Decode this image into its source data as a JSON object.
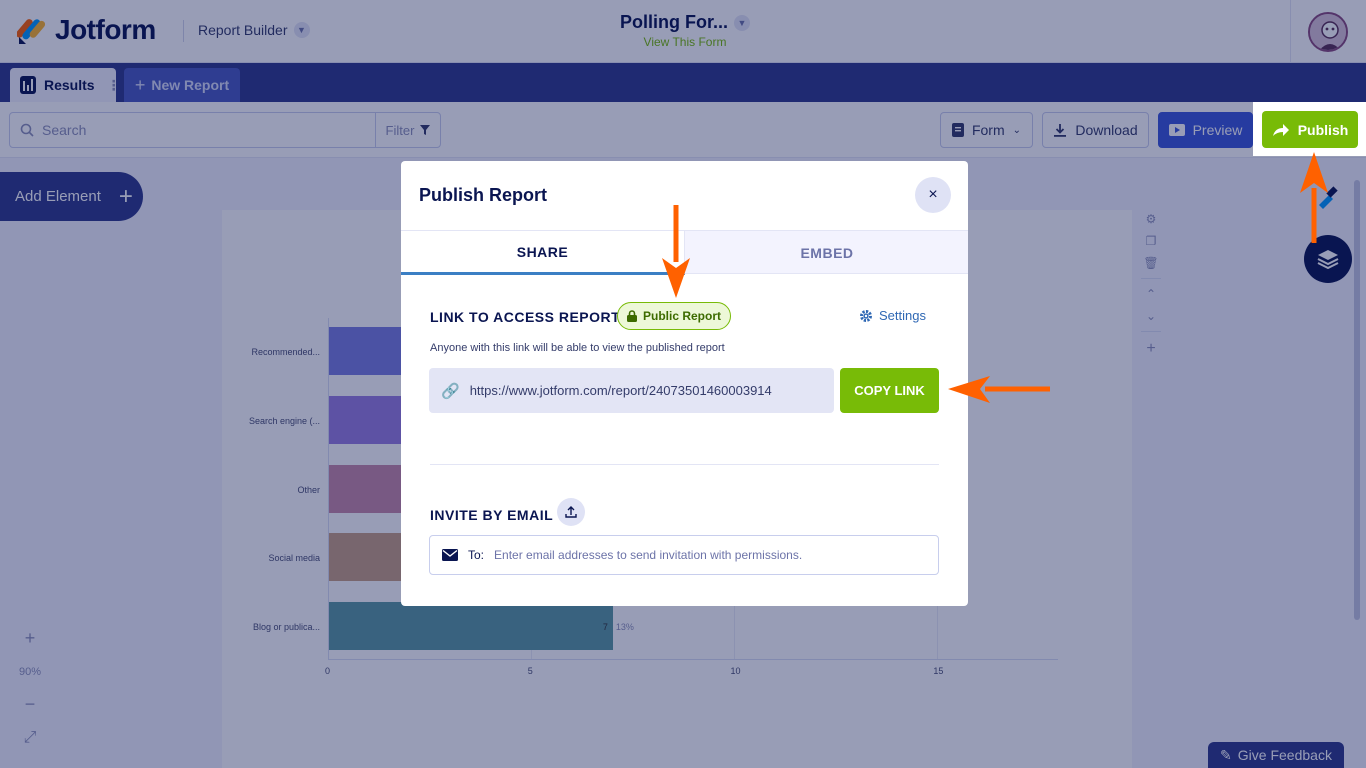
{
  "header": {
    "brand": "Jotform",
    "app_name": "Report Builder",
    "form_title": "Polling For...",
    "form_subtitle": "View This Form"
  },
  "tabs": {
    "results_label": "Results",
    "new_report_label": "New Report"
  },
  "toolbar": {
    "search_placeholder": "Search",
    "filter_label": "Filter",
    "form_label": "Form",
    "download_label": "Download",
    "preview_label": "Preview",
    "publish_label": "Publish"
  },
  "canvas": {
    "add_element_label": "Add Element",
    "zoom_level": "90%",
    "feedback_label": "Give Feedback"
  },
  "chart_data": {
    "type": "bar",
    "orientation": "horizontal",
    "categories": [
      "Recommended...",
      "Search engine (...",
      "Other",
      "Social media",
      "Blog or publica..."
    ],
    "values": [
      null,
      null,
      null,
      null,
      7
    ],
    "value_labels": [
      "",
      "",
      "",
      "",
      "7"
    ],
    "percent_labels": [
      "",
      "",
      "",
      "",
      "13%"
    ],
    "colors": [
      "#7b7fe0",
      "#9a7ee0",
      "#c98aa8",
      "#c9a084",
      "#5c9aa0"
    ],
    "xticks": [
      "0",
      "5",
      "10",
      "15"
    ],
    "xlim": [
      0,
      18
    ]
  },
  "modal": {
    "title": "Publish Report",
    "close_symbol": "×",
    "tab_share": "SHARE",
    "tab_embed": "EMBED",
    "link_section_title": "LINK TO ACCESS REPORT",
    "public_badge": "Public Report",
    "settings_label": "Settings",
    "description": "Anyone with this link will be able to view the published report",
    "report_url": "https://www.jotform.com/report/240735014600039​14",
    "copy_label": "COPY LINK",
    "invite_title": "INVITE BY EMAIL",
    "to_label": "To:",
    "email_placeholder": "Enter email addresses to send invitation with permissions."
  },
  "colors": {
    "navy": "#0a1551",
    "green": "#78bb07",
    "blue": "#3b57d9",
    "annotation_arrow": "#ff6100"
  }
}
